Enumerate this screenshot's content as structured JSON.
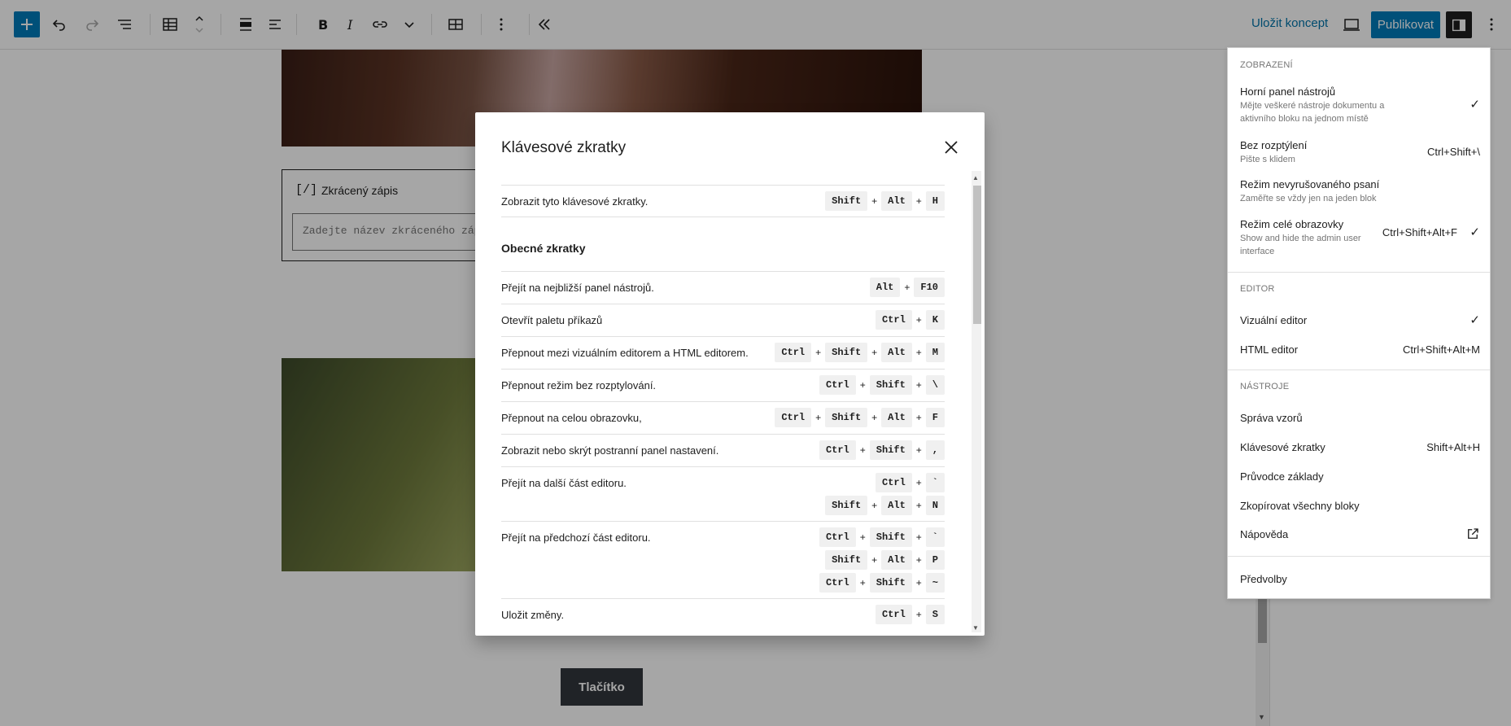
{
  "toolbar": {
    "save_draft": "Uložit koncept",
    "publish": "Publikovat"
  },
  "canvas": {
    "shortcode_icon": "[/]",
    "shortcode_label": "Zkrácený zápis",
    "shortcode_placeholder": "Zadejte název zkráceného zápisu…",
    "button_label": "Tlačítko"
  },
  "modal": {
    "title": "Klávesové zkratky",
    "general_section": "Obecné zkratky",
    "rows": [
      {
        "desc": "Zobrazit tyto klávesové zkratky.",
        "keys": [
          [
            "Shift",
            "Alt",
            "H"
          ]
        ]
      },
      {
        "desc": "Přejít na nejbližší panel nástrojů.",
        "keys": [
          [
            "Alt",
            "F10"
          ]
        ]
      },
      {
        "desc": "Otevřít paletu příkazů",
        "keys": [
          [
            "Ctrl",
            "K"
          ]
        ]
      },
      {
        "desc": "Přepnout mezi vizuálním editorem a HTML editorem.",
        "keys": [
          [
            "Ctrl",
            "Shift",
            "Alt",
            "M"
          ]
        ]
      },
      {
        "desc": "Přepnout režim bez rozptylování.",
        "keys": [
          [
            "Ctrl",
            "Shift",
            "\\"
          ]
        ]
      },
      {
        "desc": "Přepnout na celou obrazovku,",
        "keys": [
          [
            "Ctrl",
            "Shift",
            "Alt",
            "F"
          ]
        ]
      },
      {
        "desc": "Zobrazit nebo skrýt postranní panel nastavení.",
        "keys": [
          [
            "Ctrl",
            "Shift",
            ","
          ]
        ]
      },
      {
        "desc": "Přejít na další část editoru.",
        "keys": [
          [
            "Ctrl",
            "`"
          ],
          [
            "Shift",
            "Alt",
            "N"
          ]
        ]
      },
      {
        "desc": "Přejít na předchozí část editoru.",
        "keys": [
          [
            "Ctrl",
            "Shift",
            "`"
          ],
          [
            "Shift",
            "Alt",
            "P"
          ],
          [
            "Ctrl",
            "Shift",
            "~"
          ]
        ]
      },
      {
        "desc": "Uložit změny.",
        "keys": [
          [
            "Ctrl",
            "S"
          ]
        ]
      }
    ]
  },
  "menu": {
    "view_title": "Zobrazení",
    "top_toolbar": {
      "label": "Horní panel nástrojů",
      "desc": "Mějte veškeré nástroje dokumentu a aktivního bloku na jednom místě",
      "check": "✓"
    },
    "distraction_free": {
      "label": "Bez rozptýlení",
      "desc": "Pište s klidem",
      "shortcut": "Ctrl+Shift+\\"
    },
    "spotlight": {
      "label": "Režim nevyrušovaného psaní",
      "desc": "Zaměřte se vždy jen na jeden blok"
    },
    "fullscreen": {
      "label": "Režim celé obrazovky",
      "desc": "Show and hide the admin user interface",
      "shortcut": "Ctrl+Shift+Alt+F",
      "check": "✓"
    },
    "editor_title": "Editor",
    "visual_editor": {
      "label": "Vizuální editor",
      "check": "✓"
    },
    "html_editor": {
      "label": "HTML editor",
      "shortcut": "Ctrl+Shift+Alt+M"
    },
    "tools_title": "Nástroje",
    "patterns": "Správa vzorů",
    "shortcuts": {
      "label": "Klávesové zkratky",
      "shortcut": "Shift+Alt+H"
    },
    "welcome_guide": "Průvodce základy",
    "copy_blocks": "Zkopírovat všechny bloky",
    "help": "Nápověda",
    "preferences": "Předvolby"
  }
}
